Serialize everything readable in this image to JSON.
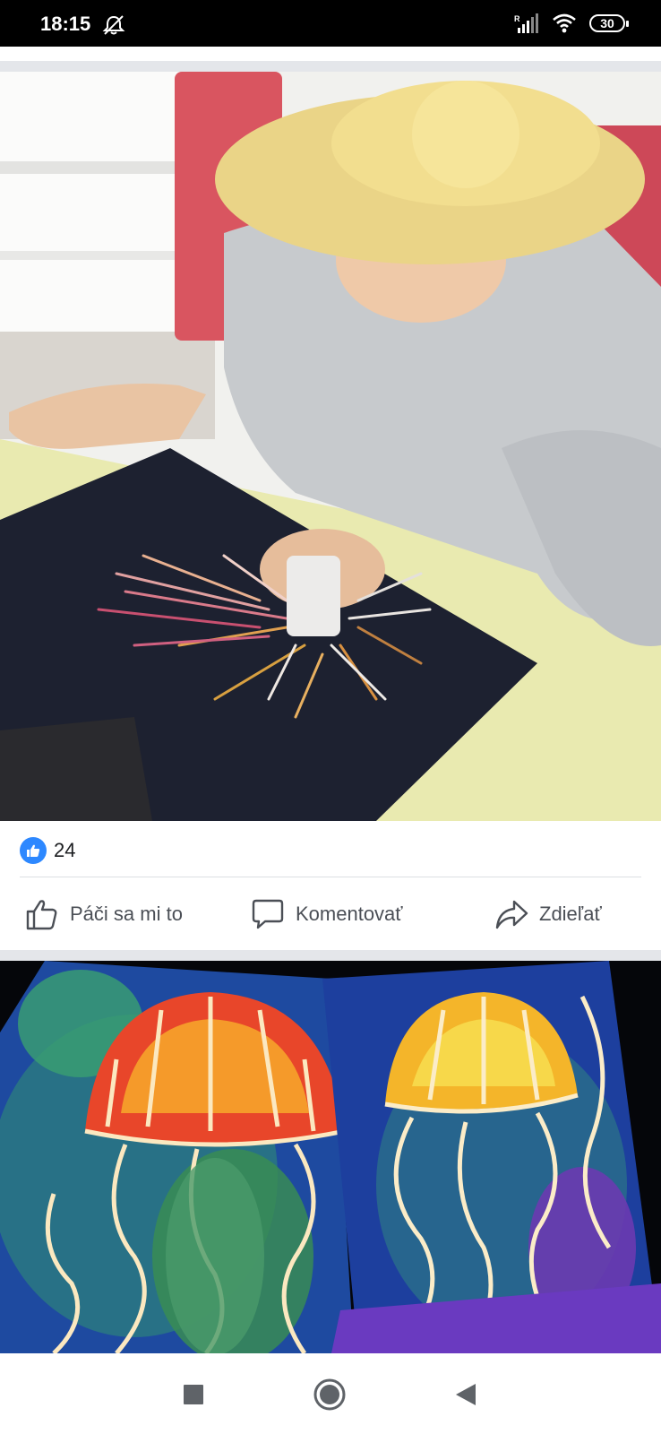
{
  "status_bar": {
    "time": "18:15",
    "battery": "30",
    "signal_label": "R"
  },
  "post1": {
    "image_icon": "photo-child-painting-jellyfish",
    "reaction_icon": "like-icon",
    "reaction_count": "24",
    "actions": {
      "like": "Páči sa mi to",
      "comment": "Komentovať",
      "share": "Zdieľať"
    }
  },
  "post2": {
    "image_icon": "photo-jellyfish-paintings"
  },
  "nav": {
    "buttons": [
      "recents",
      "home",
      "back"
    ]
  },
  "colors": {
    "like_blue": "#2d88ff",
    "text": "#1c1e21",
    "action_text": "#4b4f56",
    "separator": "#e4e6ea"
  }
}
